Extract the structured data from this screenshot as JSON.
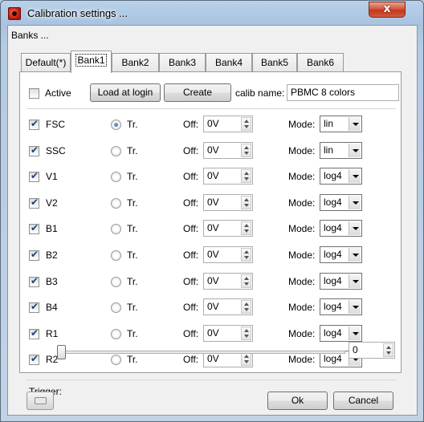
{
  "window": {
    "title": "Calibration settings ...",
    "close_label": "x"
  },
  "banks_label": "Banks ...",
  "tabs": [
    {
      "label": "Default(*)"
    },
    {
      "label": "Bank1"
    },
    {
      "label": "Bank2"
    },
    {
      "label": "Bank3"
    },
    {
      "label": "Bank4"
    },
    {
      "label": "Bank5"
    },
    {
      "label": "Bank6"
    }
  ],
  "active_tab": "Bank1",
  "top_controls": {
    "active_label": "Active",
    "active_checked": false,
    "load_button": "Load at login",
    "create_button": "Create",
    "calib_name_label": "calib name:",
    "calib_name_value": "PBMC 8 colors"
  },
  "channel_labels": {
    "tr": "Tr.",
    "off": "Off:",
    "mode": "Mode:"
  },
  "channels": [
    {
      "name": "FSC",
      "checked": true,
      "tr_selected": true,
      "off": "0V",
      "mode": "lin"
    },
    {
      "name": "SSC",
      "checked": true,
      "tr_selected": false,
      "off": "0V",
      "mode": "lin"
    },
    {
      "name": "V1",
      "checked": true,
      "tr_selected": false,
      "off": "0V",
      "mode": "log4"
    },
    {
      "name": "V2",
      "checked": true,
      "tr_selected": false,
      "off": "0V",
      "mode": "log4"
    },
    {
      "name": "B1",
      "checked": true,
      "tr_selected": false,
      "off": "0V",
      "mode": "log4"
    },
    {
      "name": "B2",
      "checked": true,
      "tr_selected": false,
      "off": "0V",
      "mode": "log4"
    },
    {
      "name": "B3",
      "checked": true,
      "tr_selected": false,
      "off": "0V",
      "mode": "log4"
    },
    {
      "name": "B4",
      "checked": true,
      "tr_selected": false,
      "off": "0V",
      "mode": "log4"
    },
    {
      "name": "R1",
      "checked": true,
      "tr_selected": false,
      "off": "0V",
      "mode": "log4"
    },
    {
      "name": "R2",
      "checked": true,
      "tr_selected": false,
      "off": "0V",
      "mode": "log4"
    }
  ],
  "trigger": {
    "label": "Trigger:",
    "value": "0"
  },
  "footer": {
    "ok": "Ok",
    "cancel": "Cancel"
  },
  "colors": {
    "accent_close": "#c3371c",
    "checkmark": "#1f3f7a",
    "radio_dot": "#1b4f96"
  }
}
